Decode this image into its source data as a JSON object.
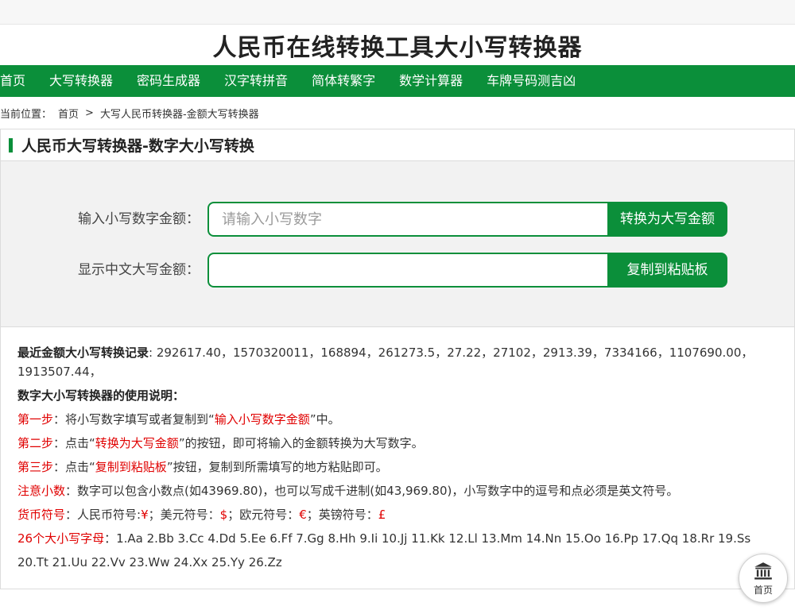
{
  "site_title": "人民币在线转换工具大小写转换器",
  "nav": [
    "首页",
    "大写转换器",
    "密码生成器",
    "汉字转拼音",
    "简体转繁字",
    "数学计算器",
    "车牌号码测吉凶"
  ],
  "breadcrumb": {
    "prefix": "当前位置：",
    "home": "首页",
    "separator": ">",
    "current": "大写人民币转换器-金额大写转换器"
  },
  "card": {
    "title": "人民币大写转换器-数字大小写转换"
  },
  "form": {
    "lower_label": "输入小写数字金额：",
    "lower_placeholder": "请输入小写数字",
    "lower_value": "",
    "convert_button": "转换为大写金额",
    "upper_label": "显示中文大写金额：",
    "upper_value": "",
    "copy_button": "复制到粘贴板"
  },
  "info": {
    "records_label": "最近金额大小写转换记录",
    "records_text": ": 292617.40，1570320011，168894，261273.5，27.22，27102，2913.39，7334166，1107690.00，1913507.44，",
    "usage_title": "数字大小写转换器的使用说明：",
    "step1_label": "第一步",
    "step1_pre": "：将小写数字填写或者复制到“",
    "step1_hl": "输入小写数字金额",
    "step1_post": "”中。",
    "step2_label": "第二步",
    "step2_pre": "：点击“",
    "step2_hl": "转换为大写金额",
    "step2_post": "”的按钮，即可将输入的金额转换为大写数字。",
    "step3_label": "第三步",
    "step3_pre": "：点击“",
    "step3_hl": "复制到粘贴板",
    "step3_post": "”按钮，复制到所需填写的地方粘贴即可。",
    "note_label": "注意小数",
    "note_text": "：数字可以包含小数点(如43969.80)，也可以写成千进制(如43,969.80)，小写数字中的逗号和点必须是英文符号。",
    "currency_label": "货币符号",
    "currency_t1": "：人民币符号:",
    "currency_rmb": "¥",
    "currency_t2": "；美元符号：",
    "currency_usd": "$",
    "currency_t3": "；欧元符号：",
    "currency_eur": "€",
    "currency_t4": "；英镑符号：",
    "currency_gbp": "£",
    "letters_label": "26个大小写字母",
    "letters_text": "：1.Aa 2.Bb 3.Cc 4.Dd 5.Ee 6.Ff 7.Gg 8.Hh 9.Ii 10.Jj 11.Kk 12.Ll 13.Mm 14.Nn 15.Oo 16.Pp 17.Qq 18.Rr 19.Ss 20.Tt 21.Uu 22.Vv 23.Ww 24.Xx 25.Yy 26.Zz"
  },
  "float_home": {
    "label": "首页",
    "icon": "bank-building-icon"
  },
  "colors": {
    "brand_green": "#0b8f3a",
    "highlight_red": "#e00000"
  }
}
